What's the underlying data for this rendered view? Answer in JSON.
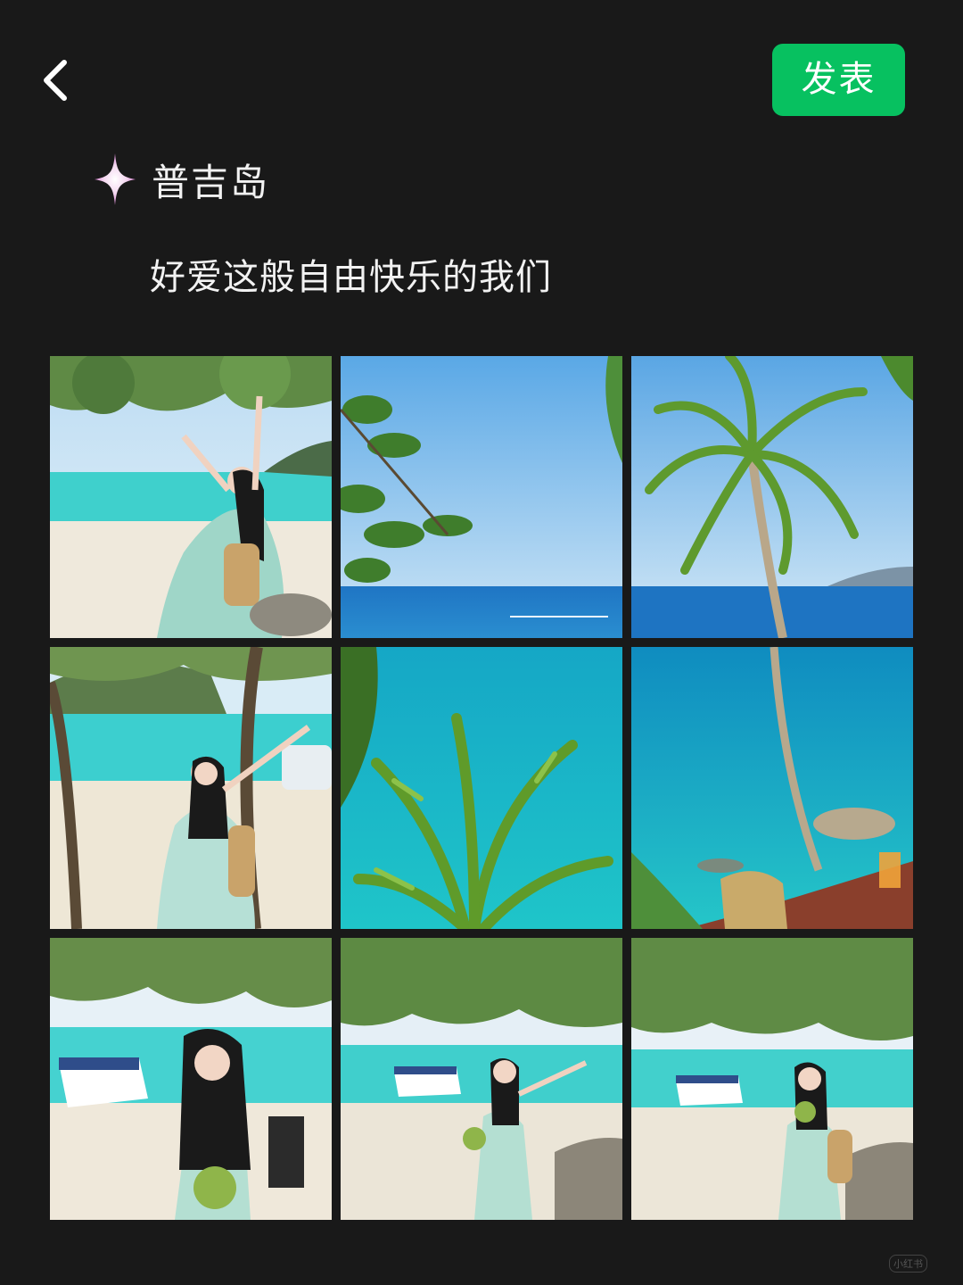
{
  "header": {
    "back_icon": "chevron-left-icon",
    "publish_label": "发表",
    "publish_color": "#07c160"
  },
  "location": {
    "icon": "sparkle-icon",
    "name": "普吉岛"
  },
  "post": {
    "caption": "好爱这般自由快乐的我们"
  },
  "photos": [
    {
      "index": 1,
      "scene": "beach-under-tree-arms-raised"
    },
    {
      "index": 2,
      "scene": "sea-view-with-leaves"
    },
    {
      "index": 3,
      "scene": "coconut-palm-over-sea"
    },
    {
      "index": 4,
      "scene": "beach-tree-waving"
    },
    {
      "index": 5,
      "scene": "palm-fronds-over-turquoise-sea"
    },
    {
      "index": 6,
      "scene": "sea-with-rocks-and-drink-table"
    },
    {
      "index": 7,
      "scene": "holding-coconut-with-boat"
    },
    {
      "index": 8,
      "scene": "walking-beach-with-boat"
    },
    {
      "index": 9,
      "scene": "beach-shade-with-boat"
    }
  ],
  "watermark": "小红书"
}
